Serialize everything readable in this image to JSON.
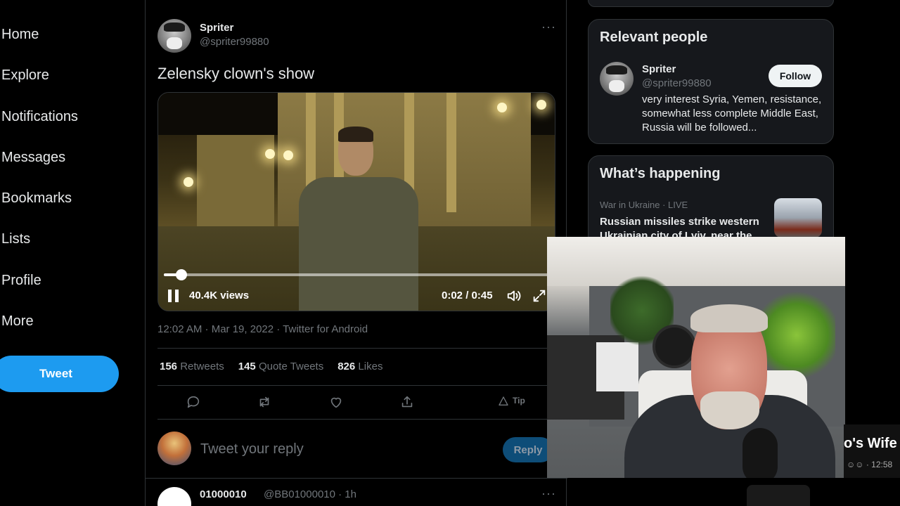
{
  "nav": {
    "items": [
      "Home",
      "Explore",
      "Notifications",
      "Messages",
      "Bookmarks",
      "Lists",
      "Profile",
      "More"
    ],
    "tweet_button": "Tweet"
  },
  "tweet": {
    "author_name": "Spriter",
    "author_handle": "@spriter99880",
    "text": "Zelensky clown's show",
    "video": {
      "views": "40.4K views",
      "time": "0:02 / 0:45",
      "progress": 0.044
    },
    "meta": "12:02 AM · Mar 19, 2022 · Twitter for Android",
    "stats": {
      "retweets_count": "156",
      "retweets_label": "Retweets",
      "quotes_count": "145",
      "quotes_label": "Quote Tweets",
      "likes_count": "826",
      "likes_label": "Likes"
    },
    "tip_label": "Tip"
  },
  "reply": {
    "placeholder": "Tweet your reply",
    "button": "Reply"
  },
  "next_tweet": {
    "name": "01000010",
    "handle_time": "@BB01000010 · 1h"
  },
  "relevant_people": {
    "title": "Relevant people",
    "name": "Spriter",
    "handle": "@spriter99880",
    "follow": "Follow",
    "bio": "very interest Syria, Yemen, resistance, somewhat less complete Middle East, Russia will be followed..."
  },
  "whats_happening": {
    "title": "What’s happening",
    "trend_meta": "War in Ukraine · LIVE",
    "trend_headline": "Russian missiles strike western Ukrainian city of Lviv, near the"
  },
  "overlay": {
    "ticker_text": "o's Wife",
    "ticker_small": "☺☺ · 12:58"
  },
  "colors": {
    "accent": "#1d9bf0",
    "background": "#000000",
    "text": "#e7e9ea",
    "muted": "#71767b"
  }
}
